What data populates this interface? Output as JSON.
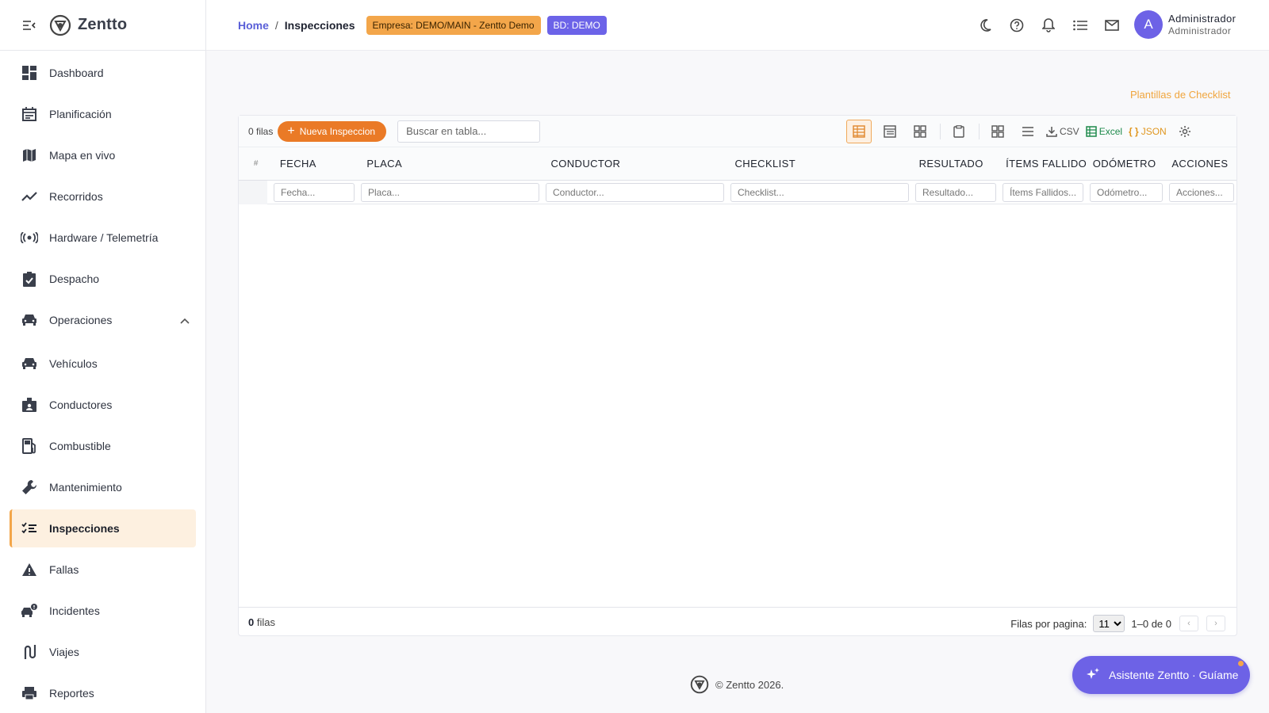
{
  "brand": {
    "name": "Zentto"
  },
  "sidebar": {
    "items": [
      {
        "label": "Dashboard",
        "icon": "dashboard-icon"
      },
      {
        "label": "Planificación",
        "icon": "calendar-icon"
      },
      {
        "label": "Mapa en vivo",
        "icon": "map-icon"
      },
      {
        "label": "Recorridos",
        "icon": "trending-icon"
      },
      {
        "label": "Hardware / Telemetría",
        "icon": "signal-icon"
      },
      {
        "label": "Despacho",
        "icon": "clipboard-check-icon"
      },
      {
        "label": "Operaciones",
        "icon": "car-icon"
      },
      {
        "label": "Vehículos",
        "icon": "car-icon"
      },
      {
        "label": "Conductores",
        "icon": "badge-icon"
      },
      {
        "label": "Combustible",
        "icon": "fuel-icon"
      },
      {
        "label": "Mantenimiento",
        "icon": "wrench-icon"
      },
      {
        "label": "Inspecciones",
        "icon": "checklist-icon"
      },
      {
        "label": "Fallas",
        "icon": "warning-icon"
      },
      {
        "label": "Incidentes",
        "icon": "car-alert-icon"
      },
      {
        "label": "Viajes",
        "icon": "route-icon"
      },
      {
        "label": "Reportes",
        "icon": "print-icon"
      }
    ]
  },
  "breadcrumb": {
    "home": "Home",
    "separator": "/",
    "current": "Inspecciones"
  },
  "chips": {
    "empresa": "Empresa: DEMO/MAIN - Zentto Demo",
    "bd": "BD: DEMO"
  },
  "user": {
    "initial": "A",
    "name": "Administrador",
    "role": "Administrador"
  },
  "page": {
    "templates_link": "Plantillas de Checklist"
  },
  "toolbar": {
    "row_count": "0 filas",
    "new_button": "Nueva Inspeccion",
    "search_placeholder": "Buscar en tabla...",
    "csv": "CSV",
    "excel": "Excel",
    "json": "JSON"
  },
  "table": {
    "num_header": "#",
    "columns": [
      {
        "label": "FECHA",
        "filter": "Fecha..."
      },
      {
        "label": "PLACA",
        "filter": "Placa..."
      },
      {
        "label": "CONDUCTOR",
        "filter": "Conductor..."
      },
      {
        "label": "CHECKLIST",
        "filter": "Checklist..."
      },
      {
        "label": "RESULTADO",
        "filter": "Resultado..."
      },
      {
        "label": "ÍTEMS FALLIDOS",
        "filter": "Ítems Fallidos..."
      },
      {
        "label": "ODÓMETRO",
        "filter": "Odómetro..."
      },
      {
        "label": "ACCIONES",
        "filter": "Acciones..."
      }
    ]
  },
  "pagination": {
    "count_num": "0",
    "count_label": "filas",
    "rows_per_page_label": "Filas por pagina:",
    "rows_per_page": "11",
    "range": "1–0 de 0"
  },
  "footer": {
    "copyright": "© Zentto 2026."
  },
  "assistant": {
    "label": "Asistente Zentto · Guíame"
  },
  "colors": {
    "accent": "#6d62e6",
    "orange": "#ea7a26",
    "amber": "#f3a64a"
  }
}
